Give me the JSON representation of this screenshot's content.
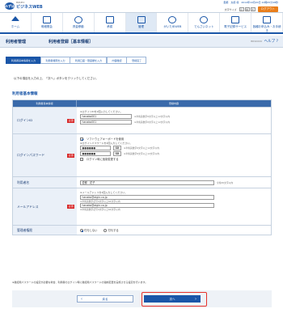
{
  "header": {
    "brand_mark": "みずほ",
    "brand_name": "ビジネスWEB",
    "brand_sub": "MIZUHO",
    "user_line": "愛都　太郎 様　2014年10月20日 10時05分48秒",
    "font_size_label": "文字サイズ",
    "font_sizes": [
      "小",
      "中",
      "大"
    ],
    "logout_label": "ログアウト"
  },
  "global_nav": [
    {
      "label": "ホーム",
      "icon": "home-icon"
    },
    {
      "label": "明細照会",
      "icon": "statement-icon"
    },
    {
      "label": "資金移動",
      "icon": "transfer-icon"
    },
    {
      "label": "承認",
      "icon": "approval-icon"
    },
    {
      "label": "管理",
      "icon": "admin-icon",
      "active": true
    },
    {
      "label": "がいためWEB",
      "icon": "foreign-icon"
    },
    {
      "label": "でんさいネット",
      "icon": "densai-icon"
    },
    {
      "label": "電子記録サービス",
      "icon": "record-icon"
    },
    {
      "label": "各種お申込み・お手続き",
      "icon": "apply-icon"
    }
  ],
  "page": {
    "section": "利用者管理",
    "title": "利用者登録［基本情報］",
    "screen_id": "BRSK006",
    "help_label": "ヘルプ"
  },
  "steps": [
    "利用者基本情報を入力",
    "利用者権限を入力",
    "利用口座・限度額を入力",
    "内容確認",
    "登録完了"
  ],
  "intro": "以下の項目を入力の上、「次へ」ボタンをクリックしてください。",
  "form": {
    "heading": "利用者基本情報",
    "col_label": "利用者基本情報",
    "col_value": "登録内容",
    "required_label": "必須",
    "login_id": {
      "label": "ログインID",
      "note": "※ログインIDを2回入力してください。",
      "value1": "hanako001",
      "value2": "hanako001",
      "hint": "※半角英数字6文字以上12文字以内"
    },
    "login_password": {
      "label": "ログインパスワード",
      "software_keyboard": "ソフトウェアキーボードを使用",
      "note": "※ログインパスワードを2回入力してください。",
      "value1": "●●●●●●",
      "value2": "●●●●●●",
      "hint": "※半角英数字6文字以上12文字以内",
      "force_change": "ログイン時に強制変更する"
    },
    "user_name": {
      "label": "利用者名",
      "value": "愛都　花子",
      "hint": "全角30文字以内"
    },
    "email": {
      "label": "メールアドレス",
      "note": "※メールアドレスを2回入力してください。",
      "value1": "hanako@aigin.co.jp",
      "hint1": "※半角英数字記号4文字以上64文字以内",
      "value2": "hanako@aigin.co.jp",
      "hint2": "※半角英数字記号4文字以上64文字以内"
    },
    "admin": {
      "label": "管理者権限",
      "option_no": "付与しない",
      "option_yes": "付与する"
    }
  },
  "footer_note": "※確認用パスワードの設定が必要な場合、利用者のログイン時に確認用パスワードの強制変更を実施させる設定を行います。",
  "buttons": {
    "back": "戻る",
    "next": "次へ"
  }
}
